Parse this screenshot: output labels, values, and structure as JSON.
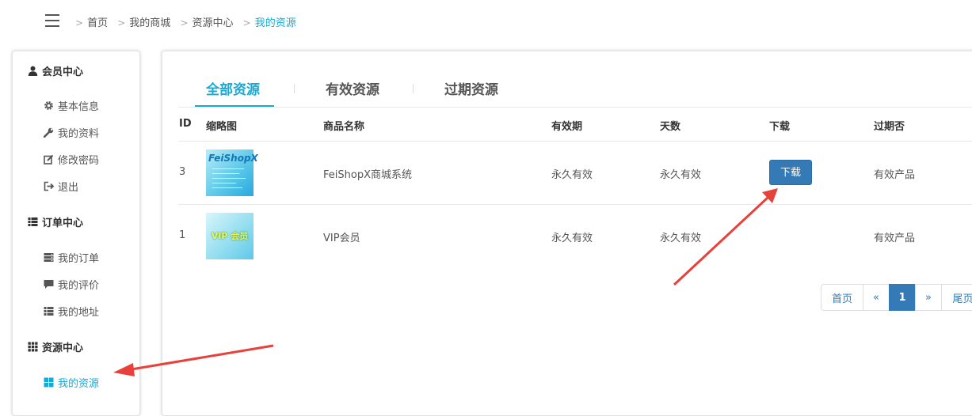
{
  "header": {
    "breadcrumb": [
      "首页",
      "我的商城",
      "资源中心",
      "我的资源"
    ]
  },
  "sidebar": {
    "member_center": {
      "title": "会员中心",
      "items": [
        "基本信息",
        "我的资料",
        "修改密码",
        "退出"
      ]
    },
    "order_center": {
      "title": "订单中心",
      "items": [
        "我的订单",
        "我的评价",
        "我的地址"
      ]
    },
    "resource_center": {
      "title": "资源中心",
      "items": [
        "我的资源"
      ]
    }
  },
  "tabs": [
    "全部资源",
    "有效资源",
    "过期资源"
  ],
  "table": {
    "headers": [
      "ID",
      "缩略图",
      "商品名称",
      "有效期",
      "天数",
      "下载",
      "过期否"
    ],
    "rows": [
      {
        "id": "3",
        "thumb_text": "FeiShopX",
        "name": "FeiShopX商城系统",
        "validity": "永久有效",
        "days": "永久有效",
        "download_label": "下载",
        "status": "有效产品"
      },
      {
        "id": "1",
        "thumb_text": "VIP 会员",
        "name": "VIP会员",
        "validity": "永久有效",
        "days": "永久有效",
        "download_label": "",
        "status": "有效产品"
      }
    ]
  },
  "pagination": {
    "first": "首页",
    "prev": "«",
    "current": "1",
    "next": "»",
    "last": "尾页"
  },
  "colors": {
    "accent": "#19a9d5",
    "button": "#337ab7",
    "arrow": "#e8403a"
  }
}
